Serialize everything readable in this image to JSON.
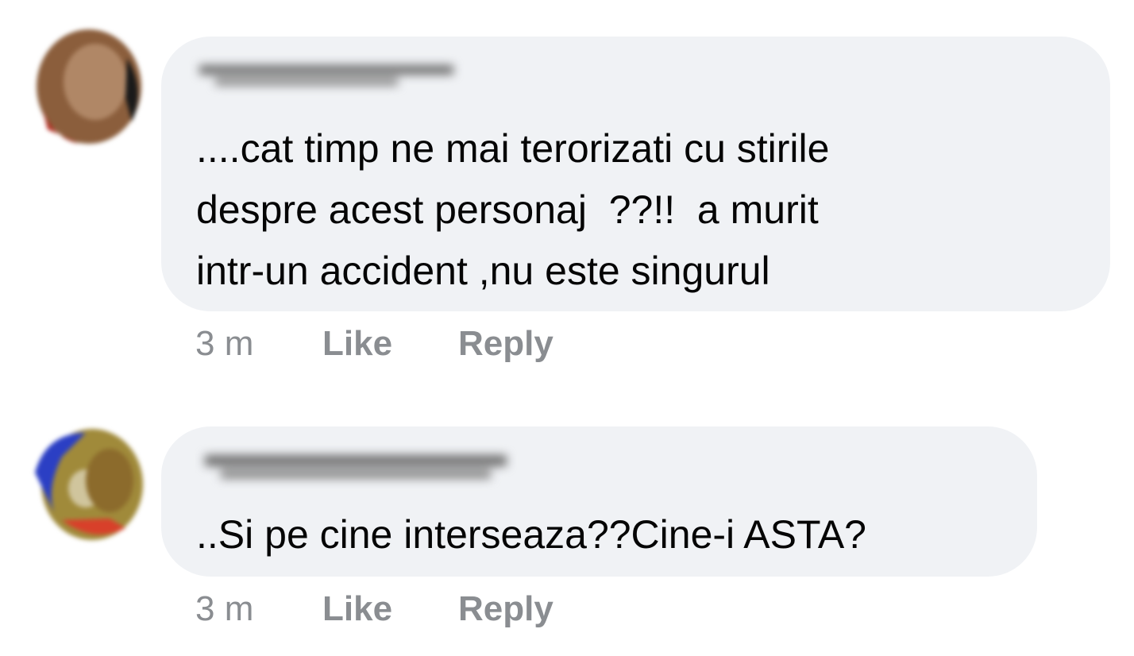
{
  "comments": [
    {
      "text": "....cat timp ne mai terorizati cu stirile\ndespre acest personaj  ??!!  a murit\nintr-un accident ,nu este singurul",
      "time": "3 m",
      "like_label": "Like",
      "reply_label": "Reply"
    },
    {
      "text": "..Si pe cine interseaza??Cine-i ASTA?",
      "time": "3 m",
      "like_label": "Like",
      "reply_label": "Reply"
    }
  ],
  "colors": {
    "bubble": "#f0f2f5",
    "text": "#050505",
    "meta": "#8a8d91"
  }
}
